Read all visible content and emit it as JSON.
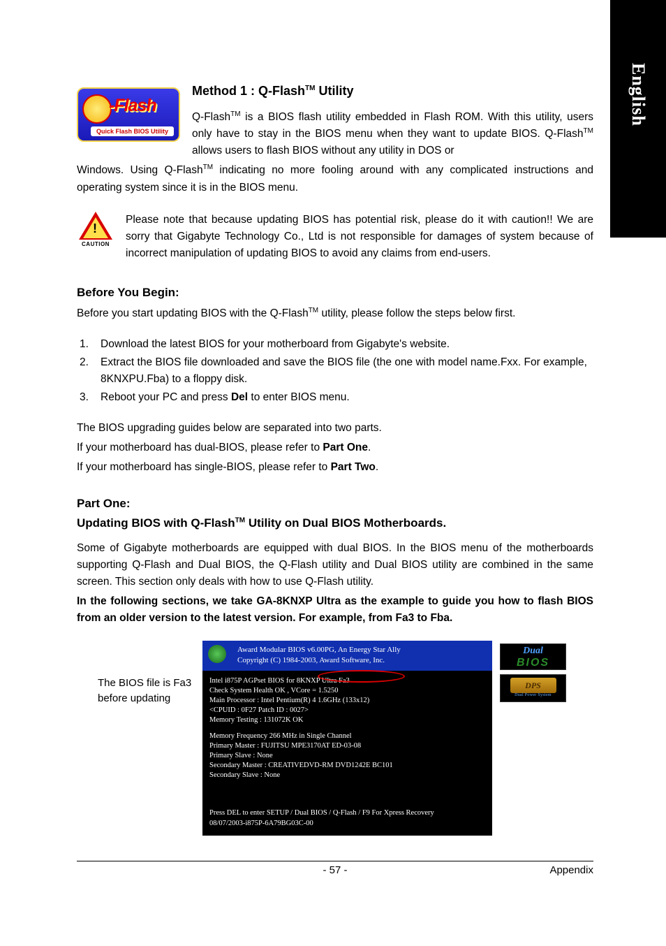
{
  "sidebar": {
    "language": "English"
  },
  "logo": {
    "main": "-Flash",
    "sub": "Quick Flash BIOS Utility"
  },
  "method": {
    "title_pre": "Method 1 : Q-Flash",
    "title_post": " Utility",
    "tm": "TM",
    "para_seg1": "Q-Flash",
    "para_seg2": " is a BIOS flash utility embedded in Flash ROM. With this utility, users only have to stay in the BIOS menu when they want to update BIOS. Q-Flash",
    "para_seg3": " allows users to flash BIOS without any utility in DOS or",
    "para2": "Windows. Using Q-Flash",
    "para2b": " indicating no more fooling around with any complicated instructions and operating system since it is in the BIOS menu."
  },
  "caution": {
    "label": "CAUTION",
    "text": "Please note that because updating BIOS has potential risk, please do it with caution!! We are sorry that Gigabyte Technology Co., Ltd is not responsible for damages of system because of incorrect manipulation of updating BIOS to avoid any claims from end-users."
  },
  "before": {
    "heading": "Before You Begin:",
    "intro_a": "Before you start updating BIOS with the Q-Flash",
    "intro_b": " utility, please follow the steps below first.",
    "steps": [
      "Download the latest BIOS for your motherboard from Gigabyte's website.",
      "Extract the BIOS file downloaded and save the BIOS file (the one with model name.Fxx. For example, 8KNXPU.Fba) to a floppy disk.",
      "Reboot your PC and press Del to enter BIOS menu."
    ],
    "step3_pre": "Reboot your PC and press ",
    "step3_bold": "Del",
    "step3_post": " to enter BIOS menu.",
    "guide1": "The BIOS upgrading guides below are separated into two parts.",
    "guide2a": "If your motherboard has dual-BIOS, please refer to ",
    "guide2b": "Part One",
    "guide3a": "If your motherboard has single-BIOS, please refer to ",
    "guide3b": "Part Two"
  },
  "partone": {
    "heading": "Part One:",
    "sub_a": "Updating BIOS with Q-Flash",
    "sub_b": " Utility on Dual BIOS Motherboards.",
    "para1": "Some of Gigabyte motherboards are equipped with dual BIOS. In the BIOS menu of the motherboards supporting Q-Flash and Dual BIOS, the Q-Flash utility and Dual BIOS utility are combined in the same screen. This section only deals with how to use Q-Flash utility.",
    "para2_bold": "In the following sections, we take GA-8KNXP Ultra as the example to guide you how to flash BIOS from an older version to the latest version. For example, from Fa3 to Fba."
  },
  "bios": {
    "caption": "The BIOS file is Fa3 before updating",
    "top1": "Award Modular BIOS v6.00PG, An Energy Star Ally",
    "top2": "Copyright  (C) 1984-2003, Award Software,  Inc.",
    "l1": "Intel i875P AGPset BIOS for 8KNXP Ultra Fa3",
    "l2": "Check System Health OK , VCore = 1.5250",
    "l3": "Main Processor : Intel Pentium(R) 4  1.6GHz (133x12)",
    "l4": "<CPUID : 0F27 Patch ID  : 0027>",
    "l5": "Memory Testing  : 131072K OK",
    "l6": "Memory Frequency 266 MHz in Single Channel",
    "l7": "Primary Master : FUJITSU MPE3170AT ED-03-08",
    "l8": "Primary Slave : None",
    "l9": "Secondary Master : CREATIVEDVD-RM DVD1242E BC101",
    "l10": "Secondary Slave : None",
    "f1": "Press DEL to enter SETUP / Dual BIOS / Q-Flash / F9 For Xpress Recovery",
    "f2": "08/07/2003-i875P-6A79BG03C-00",
    "dual_a": "Dual",
    "dual_b": "BIOS",
    "dps": "DPS",
    "dps_sub": "Dual Power System"
  },
  "footer": {
    "page": "- 57 -",
    "section": "Appendix"
  }
}
